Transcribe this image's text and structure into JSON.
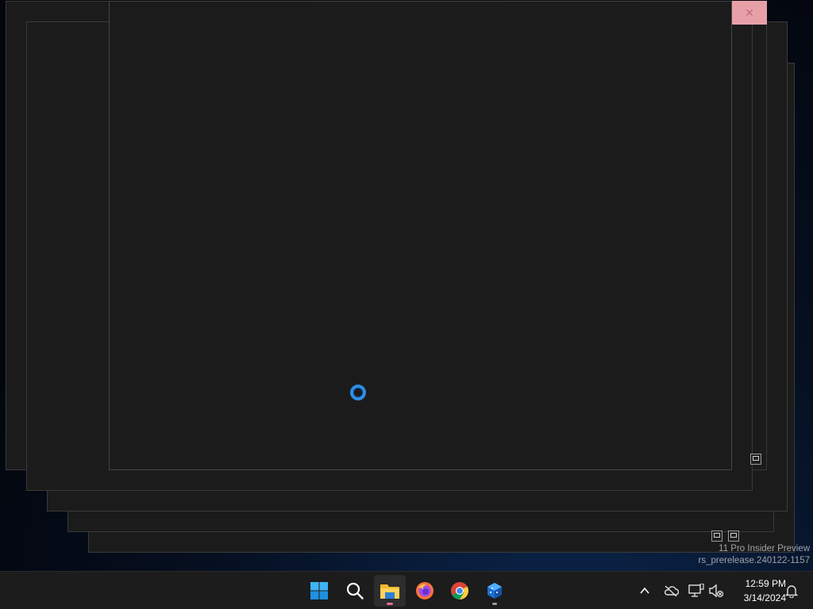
{
  "taskbar": {
    "apps": [
      {
        "name": "Start",
        "icon": "windows-logo-icon"
      },
      {
        "name": "Search",
        "icon": "search-icon"
      },
      {
        "name": "File Explorer",
        "icon": "folder-icon",
        "active": true
      },
      {
        "name": "Firefox",
        "icon": "firefox-icon"
      },
      {
        "name": "Chrome",
        "icon": "chrome-icon"
      },
      {
        "name": "App",
        "icon": "cube-app-icon"
      }
    ],
    "tray": {
      "icons": [
        "chevron-up-icon",
        "cloud-offline-icon",
        "network-icon",
        "volume-muted-icon"
      ],
      "time": "12:59 PM",
      "date": "3/14/2024",
      "notification_icon": "bell-icon"
    }
  },
  "watermark": {
    "line1": "11 Pro Insider Preview",
    "line2": "rs_prerelease.240122-1157"
  },
  "colors": {
    "spinner": "#2f8de4",
    "window_bg": "#1b1b1b",
    "taskbar_bg": "#1c1c1c",
    "close_hover": "#e8a0a8",
    "active_dot": "#e56b8b"
  },
  "state": {
    "loading": true
  }
}
